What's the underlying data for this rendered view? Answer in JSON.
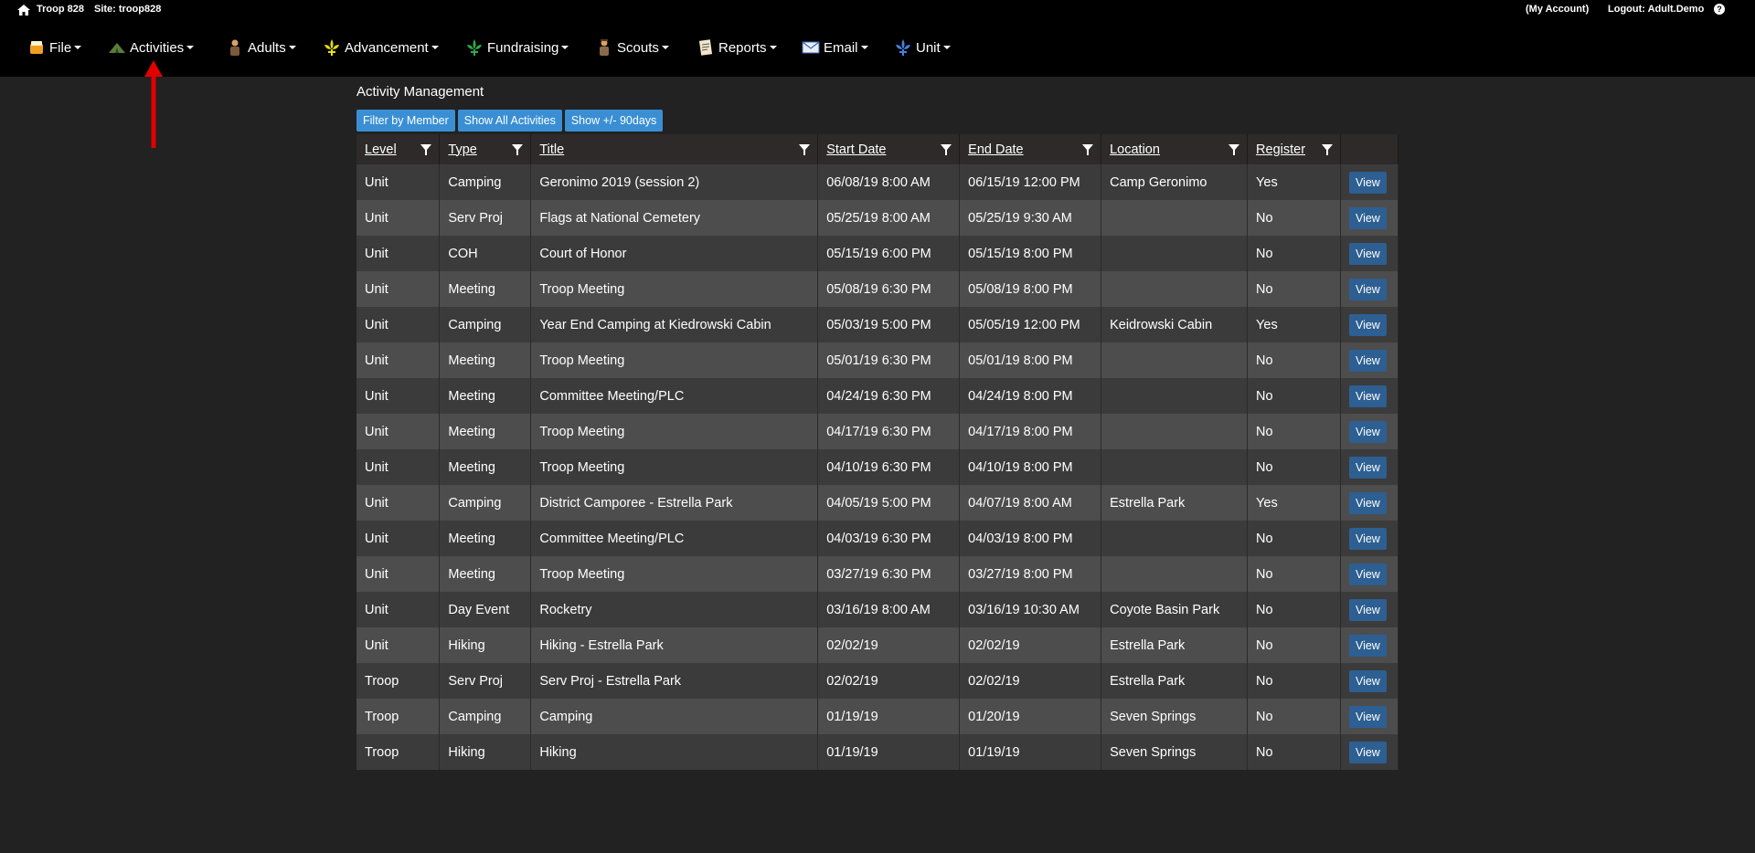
{
  "topline": {
    "troop": "Troop 828",
    "site": "Site: troop828",
    "my_account": "(My Account)",
    "logout": "Logout: Adult.Demo",
    "help": "?"
  },
  "menu": [
    {
      "label": "File",
      "icon": "file-icon"
    },
    {
      "label": "Activities",
      "icon": "activities-icon"
    },
    {
      "label": "Adults",
      "icon": "adults-icon"
    },
    {
      "label": "Advancement",
      "icon": "advancement-icon"
    },
    {
      "label": "Fundraising",
      "icon": "fundraising-icon"
    },
    {
      "label": "Scouts",
      "icon": "scouts-icon"
    },
    {
      "label": "Reports",
      "icon": "reports-icon"
    },
    {
      "label": "Email",
      "icon": "email-icon"
    },
    {
      "label": "Unit",
      "icon": "unit-icon"
    }
  ],
  "page": {
    "title": "Activity Management",
    "buttons": [
      "Filter by Member",
      "Show All Activities",
      "Show +/- 90days"
    ]
  },
  "table": {
    "columns": [
      "Level",
      "Type",
      "Title",
      "Start Date",
      "End Date",
      "Location",
      "Register",
      ""
    ],
    "view_label": "View",
    "rows": [
      [
        "Unit",
        "Camping",
        "Geronimo 2019 (session 2)",
        "06/08/19 8:00 AM",
        "06/15/19 12:00 PM",
        "Camp Geronimo",
        "Yes"
      ],
      [
        "Unit",
        "Serv Proj",
        "Flags at National Cemetery",
        "05/25/19 8:00 AM",
        "05/25/19 9:30 AM",
        "",
        "No"
      ],
      [
        "Unit",
        "COH",
        "Court of Honor",
        "05/15/19 6:00 PM",
        "05/15/19 8:00 PM",
        "",
        "No"
      ],
      [
        "Unit",
        "Meeting",
        "Troop Meeting",
        "05/08/19 6:30 PM",
        "05/08/19 8:00 PM",
        "",
        "No"
      ],
      [
        "Unit",
        "Camping",
        "Year End Camping at Kiedrowski Cabin",
        "05/03/19 5:00 PM",
        "05/05/19 12:00 PM",
        "Keidrowski Cabin",
        "Yes"
      ],
      [
        "Unit",
        "Meeting",
        "Troop Meeting",
        "05/01/19 6:30 PM",
        "05/01/19 8:00 PM",
        "",
        "No"
      ],
      [
        "Unit",
        "Meeting",
        "Committee Meeting/PLC",
        "04/24/19 6:30 PM",
        "04/24/19 8:00 PM",
        "",
        "No"
      ],
      [
        "Unit",
        "Meeting",
        "Troop Meeting",
        "04/17/19 6:30 PM",
        "04/17/19 8:00 PM",
        "",
        "No"
      ],
      [
        "Unit",
        "Meeting",
        "Troop Meeting",
        "04/10/19 6:30 PM",
        "04/10/19 8:00 PM",
        "",
        "No"
      ],
      [
        "Unit",
        "Camping",
        "District Camporee - Estrella Park",
        "04/05/19 5:00 PM",
        "04/07/19 8:00 AM",
        "Estrella Park",
        "Yes"
      ],
      [
        "Unit",
        "Meeting",
        "Committee Meeting/PLC",
        "04/03/19 6:30 PM",
        "04/03/19 8:00 PM",
        "",
        "No"
      ],
      [
        "Unit",
        "Meeting",
        "Troop Meeting",
        "03/27/19 6:30 PM",
        "03/27/19 8:00 PM",
        "",
        "No"
      ],
      [
        "Unit",
        "Day Event",
        "Rocketry",
        "03/16/19 8:00 AM",
        "03/16/19 10:30 AM",
        "Coyote Basin Park",
        "No"
      ],
      [
        "Unit",
        "Hiking",
        "Hiking - Estrella Park",
        "02/02/19",
        "02/02/19",
        "Estrella Park",
        "No"
      ],
      [
        "Troop",
        "Serv Proj",
        "Serv Proj - Estrella Park",
        "02/02/19",
        "02/02/19",
        "Estrella Park",
        "No"
      ],
      [
        "Troop",
        "Camping",
        "Camping",
        "01/19/19",
        "01/20/19",
        "Seven Springs",
        "No"
      ],
      [
        "Troop",
        "Hiking",
        "Hiking",
        "01/19/19",
        "01/19/19",
        "Seven Springs",
        "No"
      ]
    ]
  },
  "colors": {
    "background": "#222222",
    "topbar": "#000000",
    "button": "#3a8fd4",
    "view_button": "#2d5f92",
    "annotation_arrow": "#e00000"
  }
}
